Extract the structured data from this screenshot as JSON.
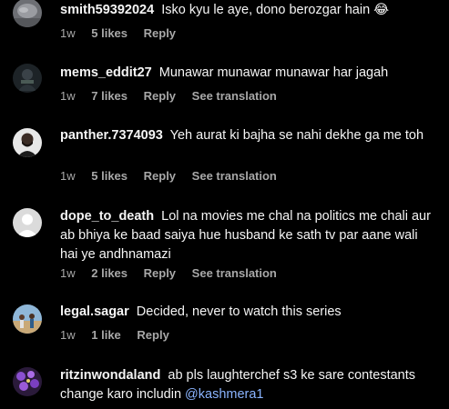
{
  "comments": [
    {
      "username": "smith59392024",
      "text": "Isko kyu le aye, dono berozgar hain 😂",
      "time": "1w",
      "likes": "5 likes",
      "reply": "Reply",
      "avatar": "grey-blob-avatar"
    },
    {
      "username": "mems_eddit27",
      "text": "Munawar munawar munawar har jagah",
      "time": "1w",
      "likes": "7 likes",
      "reply": "Reply",
      "translation": "See translation",
      "avatar": "dark-figure-avatar"
    },
    {
      "username": "panther.7374093",
      "text": "Yeh aurat ki bajha se nahi dekhe ga me toh",
      "time": "1w",
      "likes": "5 likes",
      "reply": "Reply",
      "translation": "See translation",
      "avatar": "bearded-man-avatar"
    },
    {
      "username": "dope_to_death",
      "text": "Lol na movies me chal na politics me chali aur ab bhiya ke baad saiya hue husband ke sath tv par aane wali hai ye andhnamazi",
      "time": "1w",
      "likes": "2 likes",
      "reply": "Reply",
      "translation": "See translation",
      "avatar": "default-avatar"
    },
    {
      "username": "legal.sagar",
      "text": "Decided, never to watch this series",
      "time": "1w",
      "likes": "1 like",
      "reply": "Reply",
      "avatar": "outdoor-people-avatar"
    },
    {
      "username": "ritzinwondaland",
      "text": "ab pls laughterchef s3 ke sare contestants change karo includin ",
      "mention": "@kashmera1",
      "avatar": "purple-flowers-avatar"
    }
  ],
  "colors": {
    "background": "#000000",
    "text": "#f5f5f5",
    "secondary": "#a8a8a8",
    "mention": "#8ab4ff"
  }
}
